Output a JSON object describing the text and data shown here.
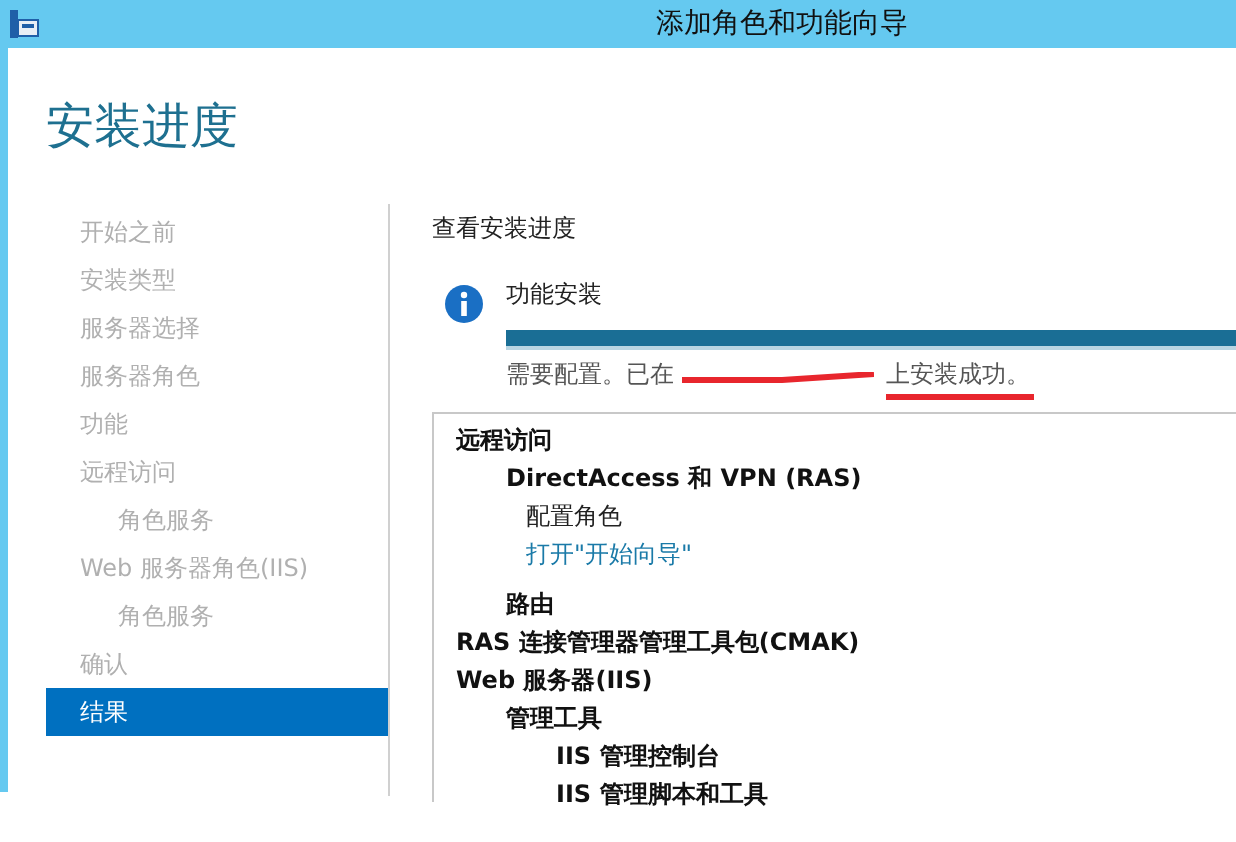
{
  "window": {
    "title": "添加角色和功能向导"
  },
  "page_title": "安装进度",
  "sidebar": {
    "items": [
      {
        "label": "开始之前",
        "selected": false
      },
      {
        "label": "安装类型",
        "selected": false
      },
      {
        "label": "服务器选择",
        "selected": false
      },
      {
        "label": "服务器角色",
        "selected": false
      },
      {
        "label": "功能",
        "selected": false
      },
      {
        "label": "远程访问",
        "selected": false,
        "children": [
          {
            "label": "角色服务",
            "selected": false
          }
        ]
      },
      {
        "label": "Web 服务器角色(IIS)",
        "selected": false,
        "children": [
          {
            "label": "角色服务",
            "selected": false
          }
        ]
      },
      {
        "label": "确认",
        "selected": false
      },
      {
        "label": "结果",
        "selected": true
      }
    ]
  },
  "progress": {
    "heading": "查看安装进度",
    "title": "功能安装",
    "level": 1,
    "status_prefix": "需要配置。已在",
    "status_suffix": "上安装成功。",
    "redacted": true,
    "underlined": true
  },
  "results": [
    {
      "kind": "item",
      "label": "远程访问",
      "children": [
        {
          "kind": "item",
          "label": "DirectAccess 和 VPN (RAS)",
          "children": [
            {
              "kind": "note",
              "label": "配置角色"
            },
            {
              "kind": "link",
              "label": "打开\"开始向导\""
            }
          ]
        },
        {
          "kind": "item",
          "label": "路由"
        }
      ]
    },
    {
      "kind": "item",
      "label": "RAS 连接管理器管理工具包(CMAK)"
    },
    {
      "kind": "item",
      "label": "Web 服务器(IIS)",
      "children": [
        {
          "kind": "item",
          "label": "管理工具",
          "children": [
            {
              "kind": "item",
              "label": "IIS 管理控制台"
            },
            {
              "kind": "item",
              "label": "IIS 管理脚本和工具"
            }
          ]
        }
      ]
    }
  ]
}
